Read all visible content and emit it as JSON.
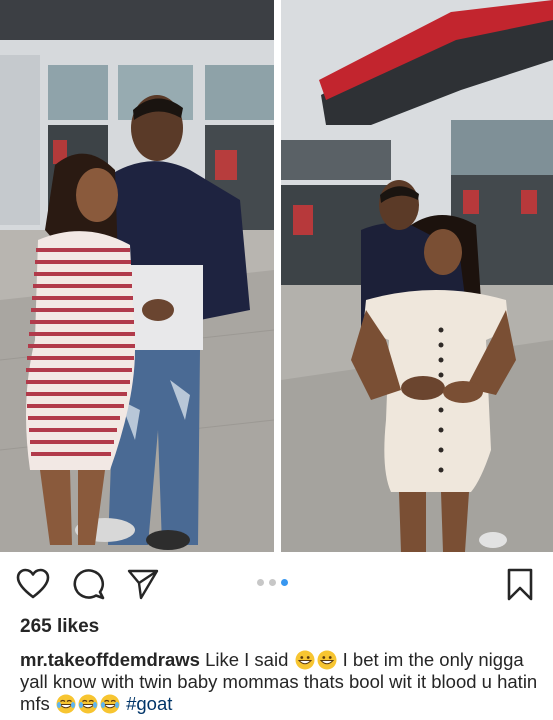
{
  "post": {
    "likes_text": "265 likes",
    "username": "mr.takeoffdemdraws",
    "caption_part1": "Like I said",
    "caption_part2": "I bet im the only nigga yall know with twin baby mommas thats bool wit it blood u hatin mfs",
    "hashtag": "#goat",
    "emoji_set_1": [
      "grinning-face",
      "grinning-face"
    ],
    "emoji_set_2": [
      "tears-of-joy",
      "tears-of-joy",
      "tears-of-joy"
    ]
  },
  "carousel": {
    "total": 3,
    "active_index": 2,
    "active_color": "#3897f0",
    "inactive_color": "#c7c7c7"
  },
  "icons": {
    "like": "heart-icon",
    "comment": "comment-icon",
    "share": "paper-plane-icon",
    "save": "bookmark-icon"
  }
}
